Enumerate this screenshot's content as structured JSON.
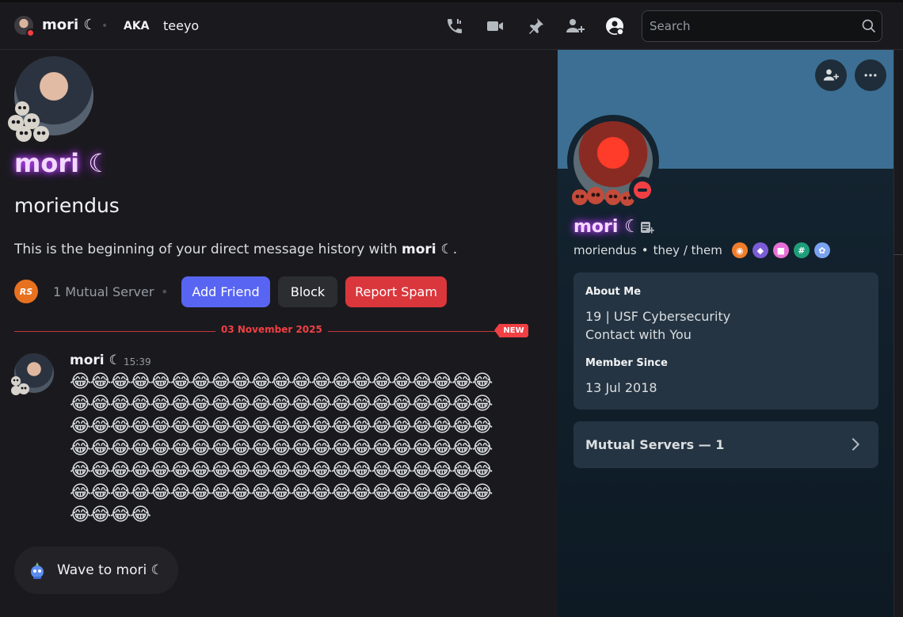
{
  "header": {
    "name": "mori ☾",
    "aka_label": "AKA",
    "aka_value": "teeyo",
    "search_placeholder": "Search"
  },
  "intro": {
    "display_name": "mori ☾",
    "username": "moriendus",
    "beginning_prefix": "This is the beginning of your direct message history with ",
    "beginning_name": "mori ☾",
    "beginning_suffix": ".",
    "server_icon_text": "RS",
    "mutual_servers": "1 Mutual Server",
    "add_friend": "Add Friend",
    "block": "Block",
    "report_spam": "Report Spam"
  },
  "divider": {
    "date": "03 November 2025",
    "new_tag": "NEW"
  },
  "message": {
    "author": "mori ☾",
    "time": "15:39",
    "emoji": "😂",
    "emoji_count": 130
  },
  "wave": {
    "label": "Wave to mori ☾"
  },
  "profile": {
    "display_name": "mori ☾",
    "username": "moriendus",
    "pronouns": "they / them",
    "separator": "•",
    "badges": [
      {
        "icon": "hypesquad-balance-icon",
        "color": "#f07d2a",
        "glyph": "◉"
      },
      {
        "icon": "shield-icon",
        "color": "#7c5cd6",
        "glyph": "◆"
      },
      {
        "icon": "nitro-icon",
        "color": "#e86fd8",
        "glyph": "■"
      },
      {
        "icon": "hashtag-icon",
        "color": "#1f9e7a",
        "glyph": "#"
      },
      {
        "icon": "boost-icon",
        "color": "#7aa2f0",
        "glyph": "✿"
      }
    ],
    "about_title": "About Me",
    "about_lines": [
      "19 | USF Cybersecurity",
      "Contact with You"
    ],
    "member_since_title": "Member Since",
    "member_since": "13 Jul 2018",
    "mutual_servers": "Mutual Servers — 1"
  },
  "colors": {
    "accent": "#5865f2",
    "danger": "#da373c",
    "banner": "#3c6f93",
    "dnd": "#f23f43"
  }
}
